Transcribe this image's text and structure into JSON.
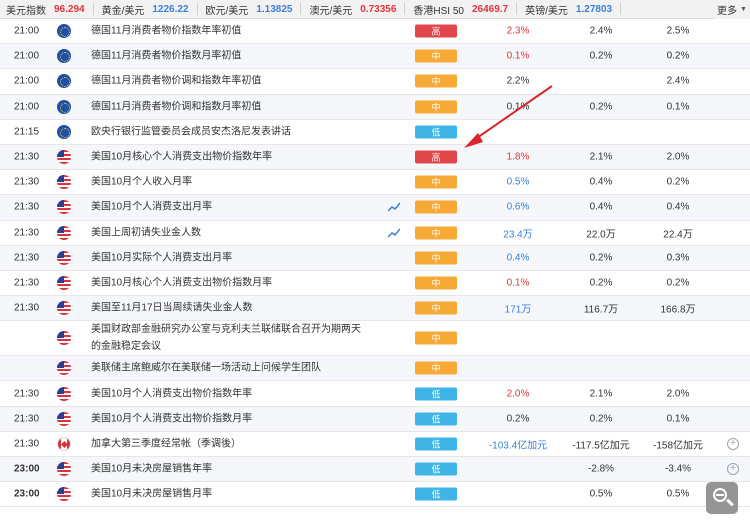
{
  "ticker": [
    {
      "name": "美元指数",
      "value": "96.294",
      "color": "red"
    },
    {
      "name": "黄金/美元",
      "value": "1226.22",
      "color": "blue"
    },
    {
      "name": "欧元/美元",
      "value": "1.13825",
      "color": "blue"
    },
    {
      "name": "澳元/美元",
      "value": "0.73356",
      "color": "red"
    },
    {
      "name": "香港HSI 50",
      "value": "26469.7",
      "color": "red"
    },
    {
      "name": "英镑/美元",
      "value": "1.27803",
      "color": "blue"
    }
  ],
  "more_label": "更多",
  "colors": {
    "high": "#e0474c",
    "medium": "#f7a935",
    "low": "#3fb4e6",
    "up": "#e0353b",
    "down": "#3d7fd6"
  },
  "rows": [
    {
      "time": "21:00",
      "flag": "eu",
      "event": "德国11月消费者物价指数年率初值",
      "chart": false,
      "importance": "高",
      "level": "hi",
      "actual": "2.3%",
      "actual_color": "red",
      "previous": "2.4%",
      "consensus": "2.5%",
      "plus": false,
      "bold": false
    },
    {
      "time": "21:00",
      "flag": "eu",
      "event": "德国11月消费者物价指数月率初值",
      "chart": false,
      "importance": "中",
      "level": "mid",
      "actual": "0.1%",
      "actual_color": "red",
      "previous": "0.2%",
      "consensus": "0.2%",
      "plus": false,
      "bold": false
    },
    {
      "time": "21:00",
      "flag": "eu",
      "event": "德国11月消费者物价调和指数年率初值",
      "chart": false,
      "importance": "中",
      "level": "mid",
      "actual": "2.2%",
      "actual_color": "dark",
      "previous": "",
      "consensus": "2.4%",
      "plus": false,
      "bold": false
    },
    {
      "time": "21:00",
      "flag": "eu",
      "event": "德国11月消费者物价调和指数月率初值",
      "chart": false,
      "importance": "中",
      "level": "mid",
      "actual": "0.1%",
      "actual_color": "dark",
      "previous": "0.2%",
      "consensus": "0.1%",
      "plus": false,
      "bold": false
    },
    {
      "time": "21:15",
      "flag": "eu",
      "event": "欧央行银行监管委员会成员安杰洛尼发表讲话",
      "chart": false,
      "importance": "低",
      "level": "lo",
      "actual": "",
      "actual_color": "dark",
      "previous": "",
      "consensus": "",
      "plus": false,
      "bold": false
    },
    {
      "time": "21:30",
      "flag": "us",
      "event": "美国10月核心个人消费支出物价指数年率",
      "chart": false,
      "importance": "高",
      "level": "hi",
      "actual": "1.8%",
      "actual_color": "red",
      "previous": "2.1%",
      "consensus": "2.0%",
      "plus": false,
      "bold": false
    },
    {
      "time": "21:30",
      "flag": "us",
      "event": "美国10月个人收入月率",
      "chart": false,
      "importance": "中",
      "level": "mid",
      "actual": "0.5%",
      "actual_color": "blue",
      "previous": "0.4%",
      "consensus": "0.2%",
      "plus": false,
      "bold": false
    },
    {
      "time": "21:30",
      "flag": "us",
      "event": "美国10月个人消费支出月率",
      "chart": true,
      "importance": "中",
      "level": "mid",
      "actual": "0.6%",
      "actual_color": "blue",
      "previous": "0.4%",
      "consensus": "0.4%",
      "plus": false,
      "bold": false
    },
    {
      "time": "21:30",
      "flag": "us",
      "event": "美国上周初请失业金人数",
      "chart": true,
      "importance": "中",
      "level": "mid",
      "actual": "23.4万",
      "actual_color": "blue",
      "previous": "22.0万",
      "consensus": "22.4万",
      "plus": false,
      "bold": false
    },
    {
      "time": "21:30",
      "flag": "us",
      "event": "美国10月实际个人消费支出月率",
      "chart": false,
      "importance": "中",
      "level": "mid",
      "actual": "0.4%",
      "actual_color": "blue",
      "previous": "0.2%",
      "consensus": "0.3%",
      "plus": false,
      "bold": false
    },
    {
      "time": "21:30",
      "flag": "us",
      "event": "美国10月核心个人消费支出物价指数月率",
      "chart": false,
      "importance": "中",
      "level": "mid",
      "actual": "0.1%",
      "actual_color": "red",
      "previous": "0.2%",
      "consensus": "0.2%",
      "plus": false,
      "bold": false
    },
    {
      "time": "21:30",
      "flag": "us",
      "event": "美国至11月17日当周续请失业金人数",
      "chart": false,
      "importance": "中",
      "level": "mid",
      "actual": "171万",
      "actual_color": "blue",
      "previous": "116.7万",
      "consensus": "166.8万",
      "plus": false,
      "bold": false
    },
    {
      "time": "",
      "flag": "us",
      "event": "美国财政部金融研究办公室与克利夫兰联储联合召开为期两天的金融稳定会议",
      "chart": false,
      "importance": "中",
      "level": "mid",
      "actual": "",
      "actual_color": "dark",
      "previous": "",
      "consensus": "",
      "plus": false,
      "bold": false,
      "tall": true
    },
    {
      "time": "",
      "flag": "us",
      "event": "美联储主席鲍威尔在美联储一场活动上问候学生团队",
      "chart": false,
      "importance": "中",
      "level": "mid",
      "actual": "",
      "actual_color": "dark",
      "previous": "",
      "consensus": "",
      "plus": false,
      "bold": false
    },
    {
      "time": "21:30",
      "flag": "us",
      "event": "美国10月个人消费支出物价指数年率",
      "chart": false,
      "importance": "低",
      "level": "lo",
      "actual": "2.0%",
      "actual_color": "red",
      "previous": "2.1%",
      "consensus": "2.0%",
      "plus": false,
      "bold": false
    },
    {
      "time": "21:30",
      "flag": "us",
      "event": "美国10月个人消费支出物价指数月率",
      "chart": false,
      "importance": "低",
      "level": "lo",
      "actual": "0.2%",
      "actual_color": "dark",
      "previous": "0.2%",
      "consensus": "0.1%",
      "plus": false,
      "bold": false
    },
    {
      "time": "21:30",
      "flag": "ca",
      "event": "加拿大第三季度经常帐（季调後）",
      "chart": false,
      "importance": "低",
      "level": "lo",
      "actual": "-103.4亿加元",
      "actual_color": "blue",
      "previous": "-117.5亿加元",
      "consensus": "-158亿加元",
      "plus": true,
      "bold": false
    },
    {
      "time": "23:00",
      "flag": "us",
      "event": "美国10月未决房屋销售年率",
      "chart": false,
      "importance": "低",
      "level": "lo",
      "actual": "",
      "actual_color": "dark",
      "previous": "-2.8%",
      "consensus": "-3.4%",
      "plus": true,
      "bold": true
    },
    {
      "time": "23:00",
      "flag": "us",
      "event": "美国10月未决房屋销售月率",
      "chart": false,
      "importance": "低",
      "level": "lo",
      "actual": "",
      "actual_color": "dark",
      "previous": "0.5%",
      "consensus": "0.5%",
      "plus": false,
      "bold": true
    }
  ]
}
